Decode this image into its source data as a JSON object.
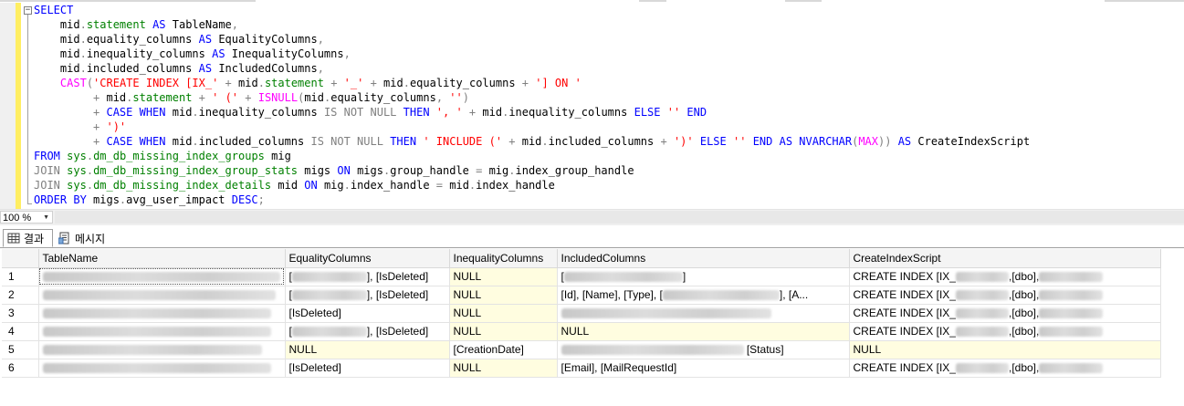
{
  "editor": {
    "lines": [
      [
        {
          "t": "SELECT",
          "c": "kw"
        }
      ],
      [
        {
          "t": "    mid"
        },
        {
          "t": ".",
          "c": "op"
        },
        {
          "t": "statement",
          "c": "sys"
        },
        {
          "t": " "
        },
        {
          "t": "AS",
          "c": "kw"
        },
        {
          "t": " TableName"
        },
        {
          "t": ",",
          "c": "op"
        }
      ],
      [
        {
          "t": "    mid"
        },
        {
          "t": ".",
          "c": "op"
        },
        {
          "t": "equality_columns "
        },
        {
          "t": "AS",
          "c": "kw"
        },
        {
          "t": " EqualityColumns"
        },
        {
          "t": ",",
          "c": "op"
        }
      ],
      [
        {
          "t": "    mid"
        },
        {
          "t": ".",
          "c": "op"
        },
        {
          "t": "inequality_columns "
        },
        {
          "t": "AS",
          "c": "kw"
        },
        {
          "t": " InequalityColumns"
        },
        {
          "t": ",",
          "c": "op"
        }
      ],
      [
        {
          "t": "    mid"
        },
        {
          "t": ".",
          "c": "op"
        },
        {
          "t": "included_columns "
        },
        {
          "t": "AS",
          "c": "kw"
        },
        {
          "t": " IncludedColumns"
        },
        {
          "t": ",",
          "c": "op"
        }
      ],
      [
        {
          "t": "    "
        },
        {
          "t": "CAST",
          "c": "fn"
        },
        {
          "t": "(",
          "c": "op"
        },
        {
          "t": "'CREATE INDEX [IX_'",
          "c": "str"
        },
        {
          "t": " + ",
          "c": "op"
        },
        {
          "t": "mid"
        },
        {
          "t": ".",
          "c": "op"
        },
        {
          "t": "statement",
          "c": "sys"
        },
        {
          "t": " + ",
          "c": "op"
        },
        {
          "t": "'_'",
          "c": "str"
        },
        {
          "t": " + ",
          "c": "op"
        },
        {
          "t": "mid"
        },
        {
          "t": ".",
          "c": "op"
        },
        {
          "t": "equality_columns "
        },
        {
          "t": "+ ",
          "c": "op"
        },
        {
          "t": "'] ON '",
          "c": "str"
        }
      ],
      [
        {
          "t": "         "
        },
        {
          "t": "+ ",
          "c": "op"
        },
        {
          "t": "mid"
        },
        {
          "t": ".",
          "c": "op"
        },
        {
          "t": "statement",
          "c": "sys"
        },
        {
          "t": " + ",
          "c": "op"
        },
        {
          "t": "' ('",
          "c": "str"
        },
        {
          "t": " + ",
          "c": "op"
        },
        {
          "t": "ISNULL",
          "c": "fn"
        },
        {
          "t": "(",
          "c": "op"
        },
        {
          "t": "mid"
        },
        {
          "t": ".",
          "c": "op"
        },
        {
          "t": "equality_columns"
        },
        {
          "t": ", ",
          "c": "op"
        },
        {
          "t": "''",
          "c": "str"
        },
        {
          "t": ")",
          "c": "op"
        }
      ],
      [
        {
          "t": "         "
        },
        {
          "t": "+ ",
          "c": "op"
        },
        {
          "t": "CASE WHEN",
          "c": "kw"
        },
        {
          "t": " mid"
        },
        {
          "t": ".",
          "c": "op"
        },
        {
          "t": "inequality_columns "
        },
        {
          "t": "IS NOT NULL",
          "c": "op"
        },
        {
          "t": " "
        },
        {
          "t": "THEN",
          "c": "kw"
        },
        {
          "t": " "
        },
        {
          "t": "', '",
          "c": "str"
        },
        {
          "t": " + ",
          "c": "op"
        },
        {
          "t": "mid"
        },
        {
          "t": ".",
          "c": "op"
        },
        {
          "t": "inequality_columns "
        },
        {
          "t": "ELSE",
          "c": "kw"
        },
        {
          "t": " "
        },
        {
          "t": "''",
          "c": "str"
        },
        {
          "t": " "
        },
        {
          "t": "END",
          "c": "kw"
        }
      ],
      [
        {
          "t": "         "
        },
        {
          "t": "+ ",
          "c": "op"
        },
        {
          "t": "')'",
          "c": "str"
        }
      ],
      [
        {
          "t": "         "
        },
        {
          "t": "+ ",
          "c": "op"
        },
        {
          "t": "CASE WHEN",
          "c": "kw"
        },
        {
          "t": " mid"
        },
        {
          "t": ".",
          "c": "op"
        },
        {
          "t": "included_columns "
        },
        {
          "t": "IS NOT NULL",
          "c": "op"
        },
        {
          "t": " "
        },
        {
          "t": "THEN",
          "c": "kw"
        },
        {
          "t": " "
        },
        {
          "t": "' INCLUDE ('",
          "c": "str"
        },
        {
          "t": " + ",
          "c": "op"
        },
        {
          "t": "mid"
        },
        {
          "t": ".",
          "c": "op"
        },
        {
          "t": "included_columns "
        },
        {
          "t": "+ ",
          "c": "op"
        },
        {
          "t": "')'",
          "c": "str"
        },
        {
          "t": " "
        },
        {
          "t": "ELSE",
          "c": "kw"
        },
        {
          "t": " "
        },
        {
          "t": "''",
          "c": "str"
        },
        {
          "t": " "
        },
        {
          "t": "END",
          "c": "kw"
        },
        {
          "t": " "
        },
        {
          "t": "AS",
          "c": "kw"
        },
        {
          "t": " "
        },
        {
          "t": "NVARCHAR",
          "c": "kw"
        },
        {
          "t": "(",
          "c": "op"
        },
        {
          "t": "MAX",
          "c": "fn"
        },
        {
          "t": "))",
          "c": "op"
        },
        {
          "t": " "
        },
        {
          "t": "AS",
          "c": "kw"
        },
        {
          "t": " CreateIndexScript"
        }
      ],
      [
        {
          "t": "FROM",
          "c": "kw"
        },
        {
          "t": " "
        },
        {
          "t": "sys",
          "c": "sys"
        },
        {
          "t": ".",
          "c": "op"
        },
        {
          "t": "dm_db_missing_index_groups",
          "c": "sys"
        },
        {
          "t": " mig"
        }
      ],
      [
        {
          "t": "JOIN",
          "c": "op"
        },
        {
          "t": " "
        },
        {
          "t": "sys",
          "c": "sys"
        },
        {
          "t": ".",
          "c": "op"
        },
        {
          "t": "dm_db_missing_index_group_stats",
          "c": "sys"
        },
        {
          "t": " migs "
        },
        {
          "t": "ON",
          "c": "kw"
        },
        {
          "t": " migs"
        },
        {
          "t": ".",
          "c": "op"
        },
        {
          "t": "group_handle "
        },
        {
          "t": "=",
          "c": "op"
        },
        {
          "t": " mig"
        },
        {
          "t": ".",
          "c": "op"
        },
        {
          "t": "index_group_handle"
        }
      ],
      [
        {
          "t": "JOIN",
          "c": "op"
        },
        {
          "t": " "
        },
        {
          "t": "sys",
          "c": "sys"
        },
        {
          "t": ".",
          "c": "op"
        },
        {
          "t": "dm_db_missing_index_details",
          "c": "sys"
        },
        {
          "t": " mid "
        },
        {
          "t": "ON",
          "c": "kw"
        },
        {
          "t": " mig"
        },
        {
          "t": ".",
          "c": "op"
        },
        {
          "t": "index_handle "
        },
        {
          "t": "=",
          "c": "op"
        },
        {
          "t": " mid"
        },
        {
          "t": ".",
          "c": "op"
        },
        {
          "t": "index_handle"
        }
      ],
      [
        {
          "t": "ORDER BY",
          "c": "kw"
        },
        {
          "t": " migs"
        },
        {
          "t": ".",
          "c": "op"
        },
        {
          "t": "avg_user_impact "
        },
        {
          "t": "DESC",
          "c": "kw"
        },
        {
          "t": ";",
          "c": "op"
        }
      ]
    ]
  },
  "zoom": {
    "value": "100 %"
  },
  "tabs": {
    "results": "결과",
    "messages": "메시지"
  },
  "grid": {
    "columns": [
      "TableName",
      "EqualityColumns",
      "InequalityColumns",
      "IncludedColumns",
      "CreateIndexScript"
    ],
    "rows": [
      {
        "n": "1",
        "table": "",
        "eq_pre": "[",
        "eq_post": "], [IsDeleted]",
        "ineq": "NULL",
        "inc_pre": "[",
        "inc_post": "]",
        "script": "CREATE INDEX [IX_",
        "script_mid": ",[dbo],"
      },
      {
        "n": "2",
        "table": "",
        "eq_pre": "[",
        "eq_post": "], [IsDeleted]",
        "ineq": "NULL",
        "inc_pre": "[Id], [Name], [Type], [",
        "inc_post": "], [A...",
        "script": "CREATE INDEX [IX_",
        "script_mid": ",[dbo],"
      },
      {
        "n": "3",
        "table": "",
        "eq_pre": "[IsDeleted]",
        "eq_post": "",
        "ineq": "NULL",
        "inc_pre": "",
        "inc_post": "",
        "script": "CREATE INDEX [IX_",
        "script_mid": ",[dbo],"
      },
      {
        "n": "4",
        "table": "",
        "eq_pre": "[",
        "eq_post": "], [IsDeleted]",
        "ineq": "NULL",
        "inc_pre": "NULL",
        "inc_post": "",
        "script": "CREATE INDEX [IX_",
        "script_mid": ",[dbo],"
      },
      {
        "n": "5",
        "table": "",
        "eq_pre": "NULL",
        "eq_post": "",
        "ineq": "[CreationDate]",
        "inc_pre": "",
        "inc_post": "[Status]",
        "script": "NULL",
        "script_mid": ""
      },
      {
        "n": "6",
        "table": "",
        "eq_pre": "[IsDeleted]",
        "eq_post": "",
        "ineq": "NULL",
        "inc_pre": "[Email], [MailRequestId]",
        "inc_post": "",
        "script": "CREATE INDEX [IX_",
        "script_mid": ",[dbo],"
      }
    ]
  }
}
